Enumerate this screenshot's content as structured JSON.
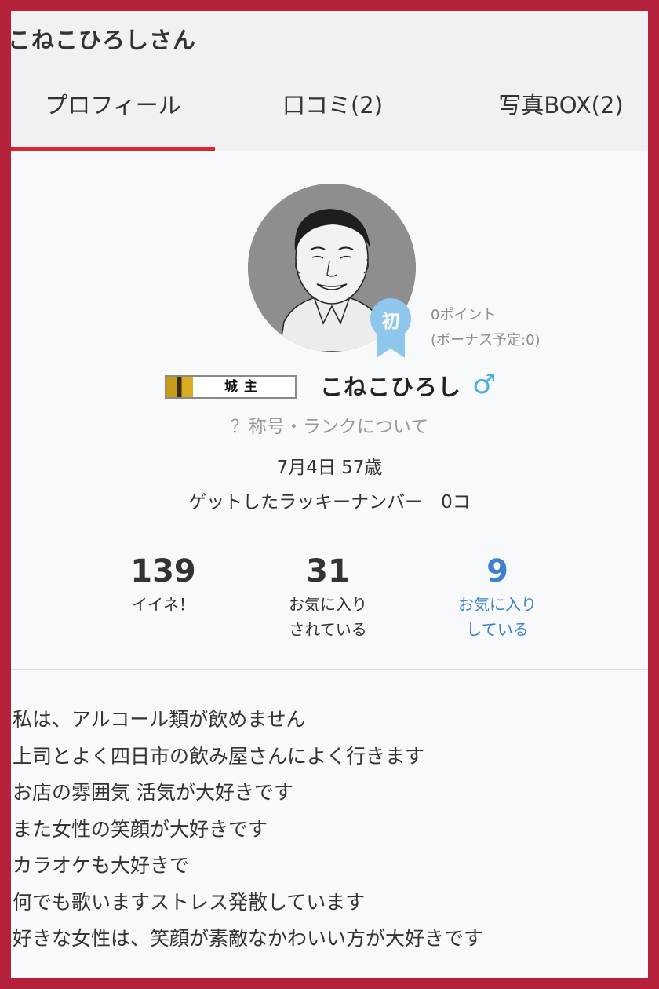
{
  "header": {
    "title": "こねこひろしさん"
  },
  "tabs": [
    {
      "label": "プロフィール",
      "active": true
    },
    {
      "label": "口コミ(2)",
      "active": false
    },
    {
      "label": "写真BOX(2)",
      "active": false
    }
  ],
  "profile": {
    "avatar_icon": "sketch-portrait-avatar",
    "beginner_badge": "初",
    "points_line1": "0ポイント",
    "points_line2": "(ボーナス予定:0)",
    "title_badge": "城主",
    "name": "こねこひろし",
    "gender_symbol": "♂",
    "rank_link": "？称号・ランクについて",
    "birthday": "7月4日 57歳",
    "lucky_number": "ゲットしたラッキーナンバー　0コ"
  },
  "stats": [
    {
      "value": "139",
      "label1": "イイネ！",
      "label2": ""
    },
    {
      "value": "31",
      "label1": "お気に入り",
      "label2": "されている"
    },
    {
      "value": "9",
      "label1": "お気に入り",
      "label2": "している"
    }
  ],
  "bio": [
    "私は、アルコール類が飲めません",
    "上司とよく四日市の飲み屋さんによく行きます",
    "お店の雰囲気 活気が大好きです",
    "また女性の笑顔が大好きです",
    "カラオケも大好きで",
    "何でも歌いますストレス発散しています",
    "好きな女性は、笑顔が素敵なかわいい方が大好きです"
  ],
  "colors": {
    "frame": "#b5203a",
    "tab_indicator": "#d9252d",
    "link_blue": "#3e82cf",
    "gender_blue": "#4ab0de",
    "badge_blue": "#8ec6ec"
  }
}
